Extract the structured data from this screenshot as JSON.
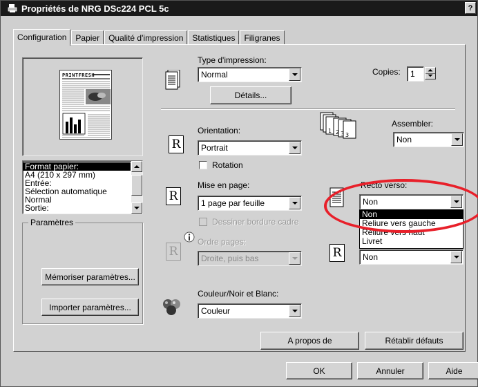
{
  "window": {
    "title": "Propriétés de NRG DSc224 PCL 5c",
    "help_label": "?"
  },
  "tabs": [
    {
      "label": "Configuration",
      "active": true
    },
    {
      "label": "Papier"
    },
    {
      "label": "Qualité d'impression"
    },
    {
      "label": "Statistiques"
    },
    {
      "label": "Filigranes"
    }
  ],
  "preview": {
    "newspaper_title": "PRINTFRESH"
  },
  "info_list": {
    "items": [
      "Format papier:",
      " A4 (210 x 297 mm)",
      "Entrée:",
      " Sélection automatique",
      " Normal",
      "Sortie:"
    ],
    "selected_index": 0
  },
  "print_type": {
    "label": "Type d'impression:",
    "value": "Normal",
    "details_button": "Détails..."
  },
  "copies": {
    "label": "Copies:",
    "value": "1"
  },
  "orientation": {
    "label": "Orientation:",
    "value": "Portrait",
    "rotation_label": "Rotation",
    "icon_letter": "R"
  },
  "collate": {
    "label": "Assembler:",
    "value": "Non"
  },
  "layout": {
    "label": "Mise en page:",
    "value": "1 page par feuille",
    "border_label": "Dessiner bordure cadre",
    "icon_letter": "R"
  },
  "duplex": {
    "label": "Recto verso:",
    "value": "Non",
    "options": [
      "Non",
      "Reliure vers gauche",
      "Reliure vers haut",
      "Livret"
    ],
    "selected_index": 0
  },
  "page_order": {
    "label": "Ordre pages:",
    "value": "Droite, puis bas",
    "icon_letter": "R",
    "info_icon": "i"
  },
  "hidden_combo": {
    "value": "Non",
    "icon_letter": "R"
  },
  "params": {
    "title": "Paramètres",
    "save_button": "Mémoriser paramètres...",
    "import_button": "Importer paramètres..."
  },
  "color": {
    "label": "Couleur/Noir et Blanc:",
    "value": "Couleur"
  },
  "about_button": "A propos de",
  "restore_button": "Rétablir défauts",
  "footer": {
    "ok": "OK",
    "cancel": "Annuler",
    "help": "Aide"
  },
  "colors": {
    "titlebar": "#1a1a1a",
    "annotation_circle": "#e8202a",
    "dialog_bg": "#d2d2d2"
  }
}
